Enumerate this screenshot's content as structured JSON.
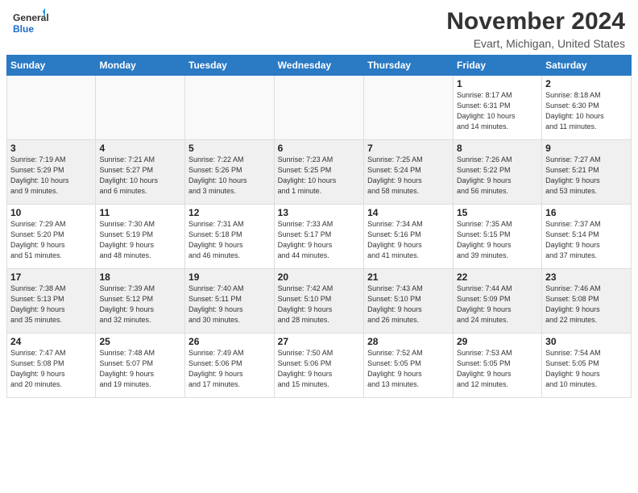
{
  "header": {
    "logo_text_general": "General",
    "logo_text_blue": "Blue",
    "month": "November 2024",
    "location": "Evart, Michigan, United States"
  },
  "calendar": {
    "days_of_week": [
      "Sunday",
      "Monday",
      "Tuesday",
      "Wednesday",
      "Thursday",
      "Friday",
      "Saturday"
    ],
    "weeks": [
      [
        {
          "day": "",
          "info": "",
          "empty": true
        },
        {
          "day": "",
          "info": "",
          "empty": true
        },
        {
          "day": "",
          "info": "",
          "empty": true
        },
        {
          "day": "",
          "info": "",
          "empty": true
        },
        {
          "day": "",
          "info": "",
          "empty": true
        },
        {
          "day": "1",
          "info": "Sunrise: 8:17 AM\nSunset: 6:31 PM\nDaylight: 10 hours\nand 14 minutes."
        },
        {
          "day": "2",
          "info": "Sunrise: 8:18 AM\nSunset: 6:30 PM\nDaylight: 10 hours\nand 11 minutes."
        }
      ],
      [
        {
          "day": "3",
          "info": "Sunrise: 7:19 AM\nSunset: 5:29 PM\nDaylight: 10 hours\nand 9 minutes."
        },
        {
          "day": "4",
          "info": "Sunrise: 7:21 AM\nSunset: 5:27 PM\nDaylight: 10 hours\nand 6 minutes."
        },
        {
          "day": "5",
          "info": "Sunrise: 7:22 AM\nSunset: 5:26 PM\nDaylight: 10 hours\nand 3 minutes."
        },
        {
          "day": "6",
          "info": "Sunrise: 7:23 AM\nSunset: 5:25 PM\nDaylight: 10 hours\nand 1 minute."
        },
        {
          "day": "7",
          "info": "Sunrise: 7:25 AM\nSunset: 5:24 PM\nDaylight: 9 hours\nand 58 minutes."
        },
        {
          "day": "8",
          "info": "Sunrise: 7:26 AM\nSunset: 5:22 PM\nDaylight: 9 hours\nand 56 minutes."
        },
        {
          "day": "9",
          "info": "Sunrise: 7:27 AM\nSunset: 5:21 PM\nDaylight: 9 hours\nand 53 minutes."
        }
      ],
      [
        {
          "day": "10",
          "info": "Sunrise: 7:29 AM\nSunset: 5:20 PM\nDaylight: 9 hours\nand 51 minutes."
        },
        {
          "day": "11",
          "info": "Sunrise: 7:30 AM\nSunset: 5:19 PM\nDaylight: 9 hours\nand 48 minutes."
        },
        {
          "day": "12",
          "info": "Sunrise: 7:31 AM\nSunset: 5:18 PM\nDaylight: 9 hours\nand 46 minutes."
        },
        {
          "day": "13",
          "info": "Sunrise: 7:33 AM\nSunset: 5:17 PM\nDaylight: 9 hours\nand 44 minutes."
        },
        {
          "day": "14",
          "info": "Sunrise: 7:34 AM\nSunset: 5:16 PM\nDaylight: 9 hours\nand 41 minutes."
        },
        {
          "day": "15",
          "info": "Sunrise: 7:35 AM\nSunset: 5:15 PM\nDaylight: 9 hours\nand 39 minutes."
        },
        {
          "day": "16",
          "info": "Sunrise: 7:37 AM\nSunset: 5:14 PM\nDaylight: 9 hours\nand 37 minutes."
        }
      ],
      [
        {
          "day": "17",
          "info": "Sunrise: 7:38 AM\nSunset: 5:13 PM\nDaylight: 9 hours\nand 35 minutes."
        },
        {
          "day": "18",
          "info": "Sunrise: 7:39 AM\nSunset: 5:12 PM\nDaylight: 9 hours\nand 32 minutes."
        },
        {
          "day": "19",
          "info": "Sunrise: 7:40 AM\nSunset: 5:11 PM\nDaylight: 9 hours\nand 30 minutes."
        },
        {
          "day": "20",
          "info": "Sunrise: 7:42 AM\nSunset: 5:10 PM\nDaylight: 9 hours\nand 28 minutes."
        },
        {
          "day": "21",
          "info": "Sunrise: 7:43 AM\nSunset: 5:10 PM\nDaylight: 9 hours\nand 26 minutes."
        },
        {
          "day": "22",
          "info": "Sunrise: 7:44 AM\nSunset: 5:09 PM\nDaylight: 9 hours\nand 24 minutes."
        },
        {
          "day": "23",
          "info": "Sunrise: 7:46 AM\nSunset: 5:08 PM\nDaylight: 9 hours\nand 22 minutes."
        }
      ],
      [
        {
          "day": "24",
          "info": "Sunrise: 7:47 AM\nSunset: 5:08 PM\nDaylight: 9 hours\nand 20 minutes."
        },
        {
          "day": "25",
          "info": "Sunrise: 7:48 AM\nSunset: 5:07 PM\nDaylight: 9 hours\nand 19 minutes."
        },
        {
          "day": "26",
          "info": "Sunrise: 7:49 AM\nSunset: 5:06 PM\nDaylight: 9 hours\nand 17 minutes."
        },
        {
          "day": "27",
          "info": "Sunrise: 7:50 AM\nSunset: 5:06 PM\nDaylight: 9 hours\nand 15 minutes."
        },
        {
          "day": "28",
          "info": "Sunrise: 7:52 AM\nSunset: 5:05 PM\nDaylight: 9 hours\nand 13 minutes."
        },
        {
          "day": "29",
          "info": "Sunrise: 7:53 AM\nSunset: 5:05 PM\nDaylight: 9 hours\nand 12 minutes."
        },
        {
          "day": "30",
          "info": "Sunrise: 7:54 AM\nSunset: 5:05 PM\nDaylight: 9 hours\nand 10 minutes."
        }
      ]
    ]
  }
}
